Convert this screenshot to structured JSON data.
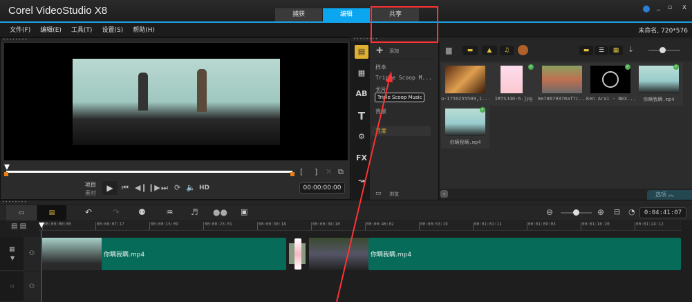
{
  "app": {
    "title": "Corel VideoStudio X8",
    "tabs": [
      "捕获",
      "编辑",
      "共享"
    ],
    "active_tab": 1,
    "project_info": "未命名, 720*576",
    "accent": "#1aa3e8"
  },
  "menu": [
    "文件(F)",
    "编辑(E)",
    "工具(T)",
    "设置(S)",
    "帮助(H)"
  ],
  "preview": {
    "mode_project": "项目",
    "mode_clip": "素材",
    "timecode": "00:00:00:00",
    "hd_label": "HD",
    "mark_in": "[",
    "mark_out": "]"
  },
  "side_icons": [
    "media-icon",
    "instant-project-icon",
    "transition-icon",
    "title-icon",
    "graphic-icon",
    "filter-icon",
    "path-icon"
  ],
  "fx_label": "FX",
  "title_icon_label": "T",
  "folders": {
    "add_label": "添加",
    "items": [
      "样本",
      "Triple Scoop M...",
      "长片",
      "背景",
      "百度"
    ],
    "selected": 4,
    "tooltip": "Triple Scoop Music",
    "browse_label": "浏览"
  },
  "library": {
    "items": [
      {
        "name": "u-1750255509,1...",
        "checked": false,
        "kind": "photo"
      },
      {
        "name": "1RTSJ40-6.jpg",
        "checked": true,
        "kind": "anime"
      },
      {
        "name": "8e78679370af7c...",
        "checked": false,
        "kind": "group"
      },
      {
        "name": "Ken Arai - NEX...",
        "checked": true,
        "kind": "audio"
      },
      {
        "name": "你瞒我瞒.mp4",
        "checked": true,
        "kind": "video"
      },
      {
        "name": "你瞒我瞒.mp4",
        "checked": true,
        "kind": "video"
      }
    ],
    "options_label": "选项"
  },
  "timeline": {
    "duration": "0:04:41:07",
    "ticks": [
      "00:00:00:00",
      "00:00:07:17",
      "00:00:15:09",
      "00:00:23:01",
      "00:00:30:18",
      "00:00:38:10",
      "00:00:46:02",
      "00:00:53:19",
      "00:01:01:11",
      "00:01:09:03",
      "00:01:16:20",
      "00:01:24:12"
    ],
    "clips": [
      "你瞒我瞒.mp4",
      "你瞒我瞒.mp4"
    ],
    "zoom_fraction": 0.5
  },
  "annotation_color": "#ff3333"
}
